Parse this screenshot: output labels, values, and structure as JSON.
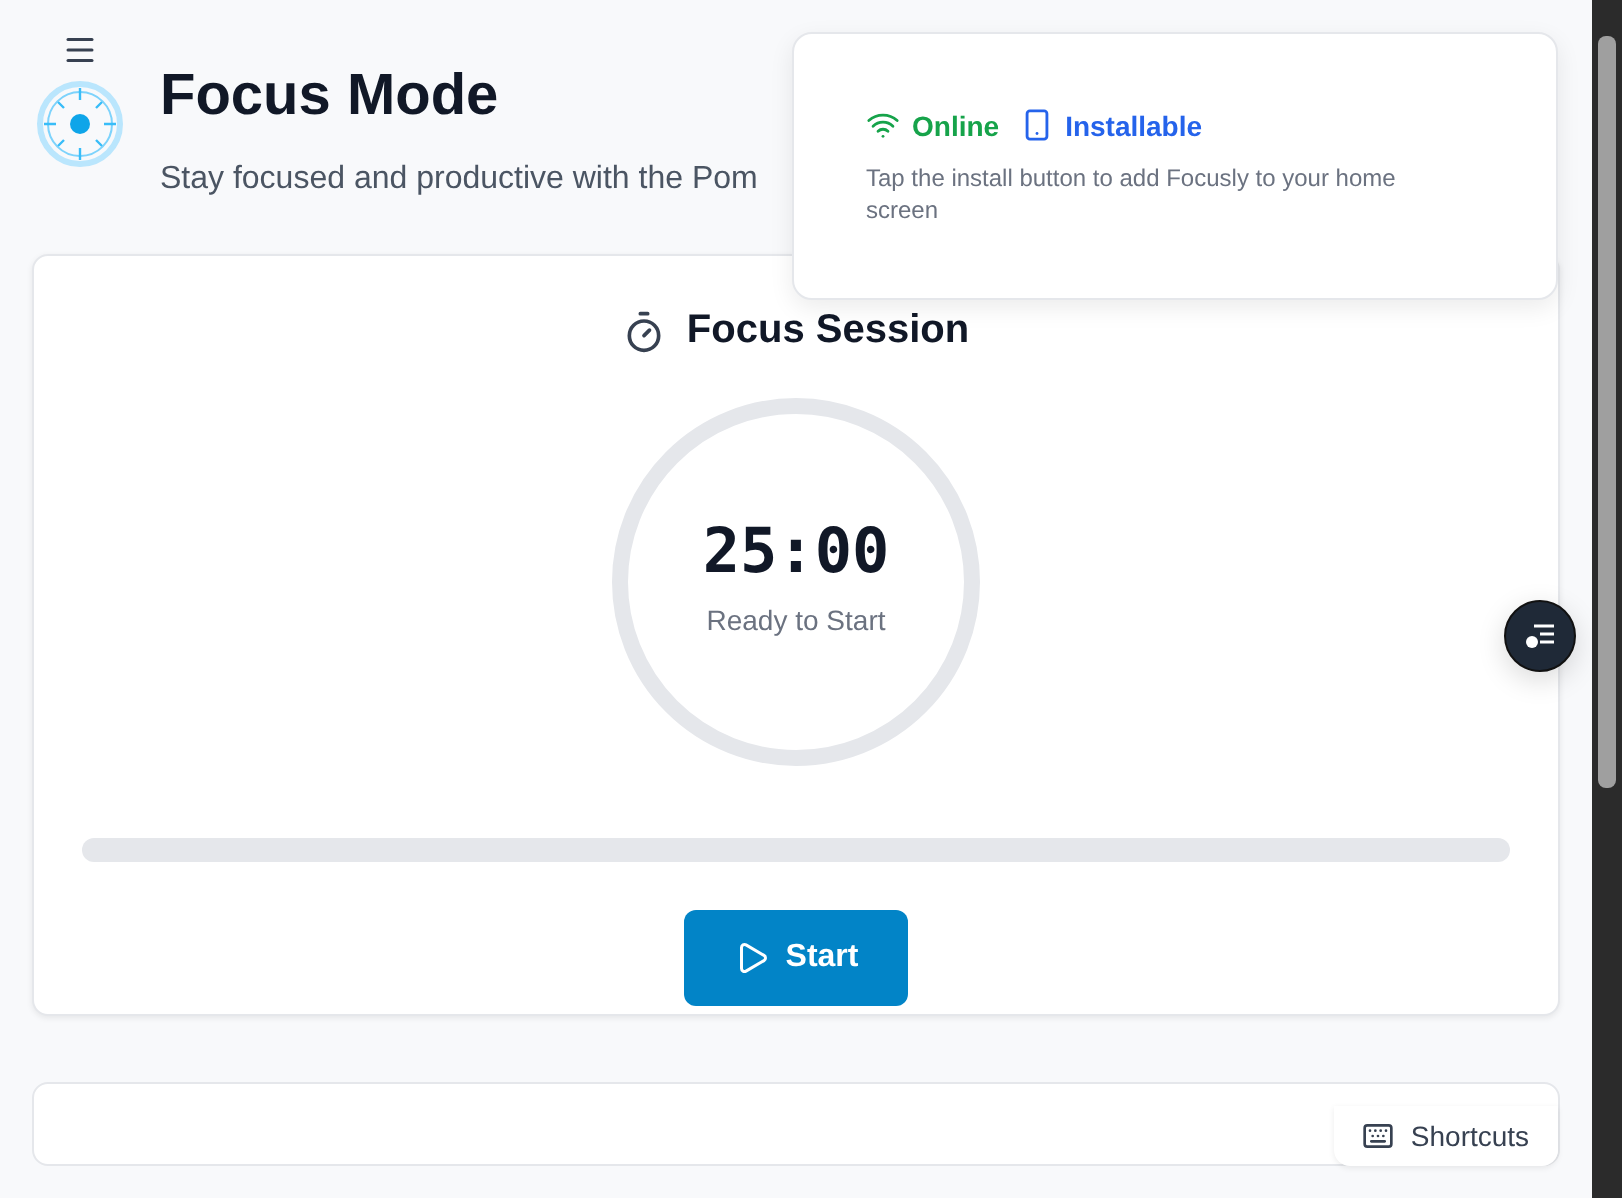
{
  "header": {
    "title": "Focus Mode",
    "subtitle": "Stay focused and productive with the Pom"
  },
  "status_popup": {
    "online": {
      "label": "Online",
      "on": true
    },
    "installable": {
      "label": "Installable",
      "on": true
    },
    "hint": "Tap the install button to add Focusly to your home screen"
  },
  "session": {
    "title": "Focus Session",
    "time": "25:00",
    "status": "Ready to Start",
    "progress": {
      "level": 0
    },
    "start_button": "Start"
  },
  "shortcuts_button": "Shortcuts"
}
